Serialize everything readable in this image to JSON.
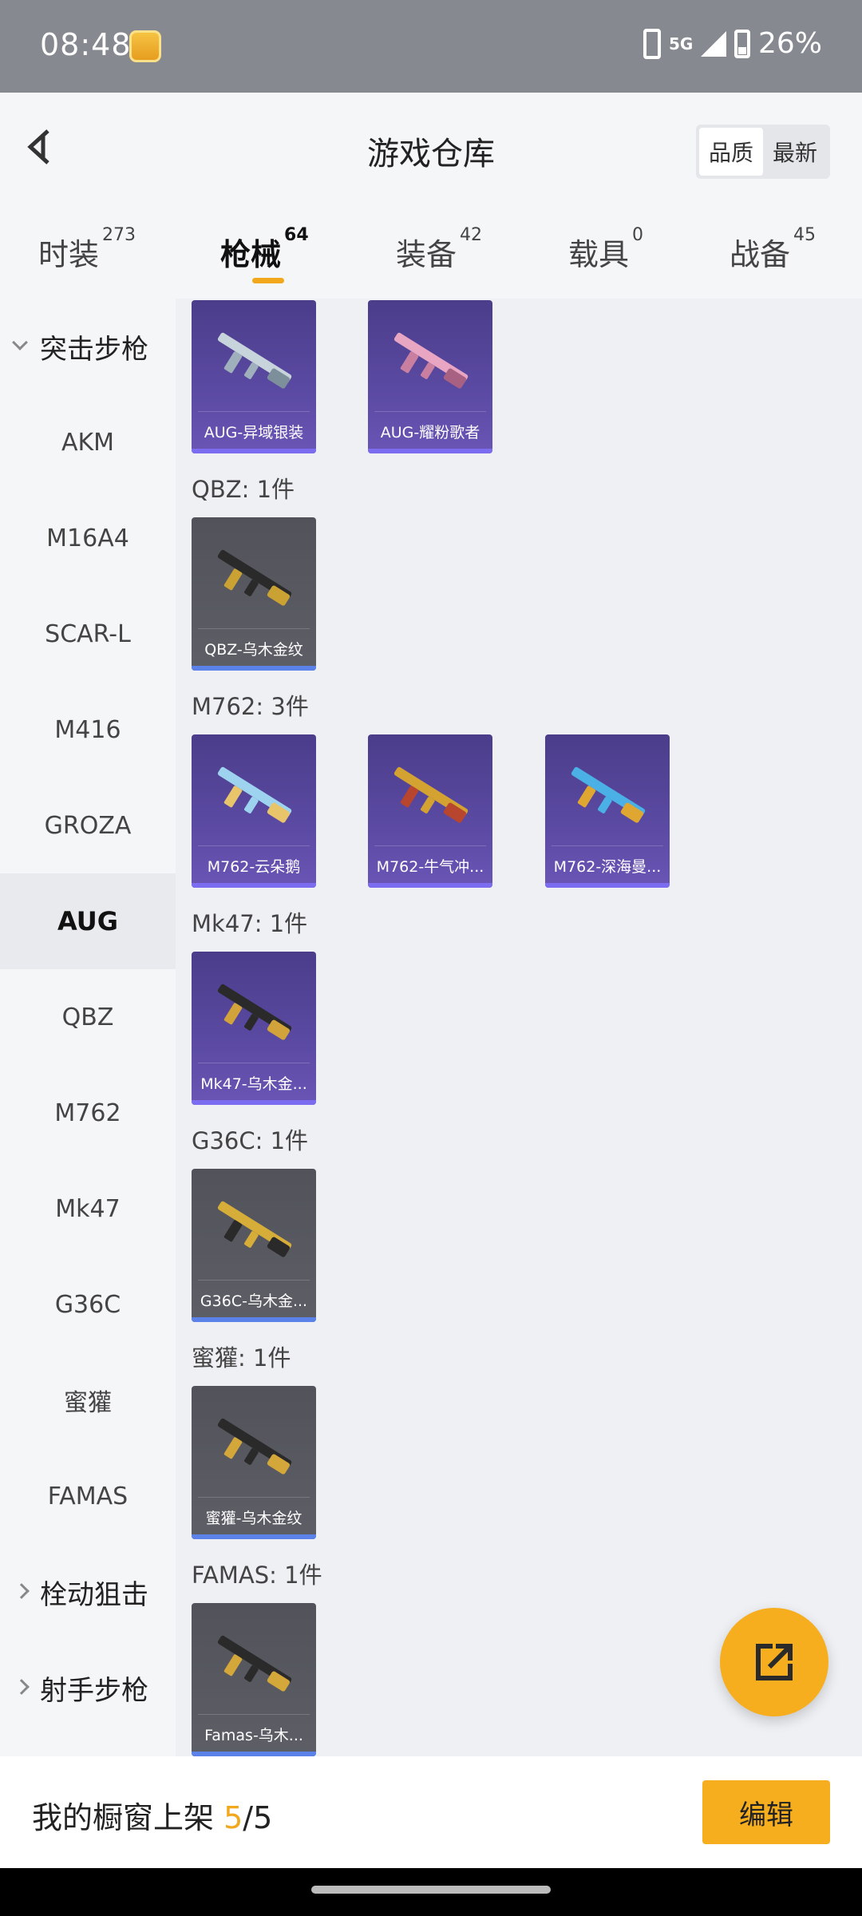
{
  "status_bar": {
    "time": "08:48",
    "network": "5G",
    "battery": "26%",
    "battery_level": 0.26
  },
  "header": {
    "title": "游戏仓库",
    "sort_options": [
      "品质",
      "最新"
    ],
    "sort_selected": "品质"
  },
  "tabs": [
    {
      "label": "时装",
      "count": "273"
    },
    {
      "label": "枪械",
      "count": "64"
    },
    {
      "label": "装备",
      "count": "42"
    },
    {
      "label": "载具",
      "count": "0"
    },
    {
      "label": "战备",
      "count": "45"
    }
  ],
  "active_tab": "枪械",
  "sidebar": {
    "groups": [
      {
        "label": "突击步枪",
        "expanded": true
      },
      {
        "label": "栓动狙击",
        "expanded": false
      },
      {
        "label": "射手步枪",
        "expanded": false
      }
    ],
    "items": [
      "AKM",
      "M16A4",
      "SCAR-L",
      "M416",
      "GROZA",
      "AUG",
      "QBZ",
      "M762",
      "Mk47",
      "G36C",
      "蜜獾",
      "FAMAS"
    ],
    "active_item": "AUG"
  },
  "sections": [
    {
      "label": "",
      "items": [
        {
          "name": "AUG-异域银装",
          "quality": "purple"
        },
        {
          "name": "AUG-耀粉歌者",
          "quality": "purple"
        }
      ]
    },
    {
      "label": "QBZ: 1件",
      "items": [
        {
          "name": "QBZ-乌木金纹",
          "quality": "gray"
        }
      ]
    },
    {
      "label": "M762: 3件",
      "items": [
        {
          "name": "M762-云朵鹅",
          "quality": "purple"
        },
        {
          "name": "M762-牛气冲...",
          "quality": "purple"
        },
        {
          "name": "M762-深海曼...",
          "quality": "purple"
        }
      ]
    },
    {
      "label": "Mk47: 1件",
      "items": [
        {
          "name": "Mk47-乌木金...",
          "quality": "purple"
        }
      ]
    },
    {
      "label": "G36C: 1件",
      "items": [
        {
          "name": "G36C-乌木金...",
          "quality": "gray"
        }
      ]
    },
    {
      "label": "蜜獾: 1件",
      "items": [
        {
          "name": "蜜獾-乌木金纹",
          "quality": "gray"
        }
      ]
    },
    {
      "label": "FAMAS: 1件",
      "items": [
        {
          "name": "Famas-乌木...",
          "quality": "gray"
        }
      ]
    }
  ],
  "bottom_bar": {
    "showcase_label": "我的橱窗上架",
    "showcase_count": "5",
    "showcase_total": "/5",
    "edit_label": "编辑"
  },
  "colors": {
    "accent": "#f6ae1f",
    "purple_card": "#5b4aa3",
    "gray_card": "#5d5e66"
  },
  "icons": {
    "back": "chevron-left-icon",
    "share": "share-external-icon"
  }
}
